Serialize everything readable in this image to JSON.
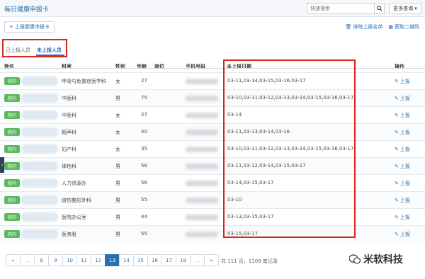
{
  "app": {
    "title": "每日健康申报卡"
  },
  "search": {
    "placeholder": "快速搜索",
    "more_label": "更多查询"
  },
  "toolbar": {
    "report_label": "上报健康申报卡",
    "delete_label": "排除上报名单",
    "qr_label": "获取二维码"
  },
  "tabs": [
    {
      "label": "已上报人员"
    },
    {
      "label": "未上报人员",
      "active": true
    }
  ],
  "table": {
    "headers": {
      "name": "姓名",
      "dept": "科室",
      "gender": "性别",
      "age": "年龄",
      "post": "岗位",
      "phone": "手机号码",
      "dates": "未上报日期",
      "action": "操作"
    },
    "badge": "院内",
    "action_label": "上报",
    "rows": [
      {
        "dept": "呼吸与危重症医学科",
        "gender": "女",
        "age": "27",
        "dates": "03-11,03-14,03-15,03-16,03-17"
      },
      {
        "dept": "中医科",
        "gender": "男",
        "age": "75",
        "dates": "03-10,03-11,03-12,03-13,03-14,03-15,03-16,03-17"
      },
      {
        "dept": "中医科",
        "gender": "女",
        "age": "27",
        "dates": "03-14"
      },
      {
        "dept": "超声科",
        "gender": "女",
        "age": "40",
        "dates": "03-11,03-13,03-14,03-16"
      },
      {
        "dept": "妇产科",
        "gender": "女",
        "age": "35",
        "dates": "03-10,03-11,03-12,03-13,03-14,03-15,03-16,03-17"
      },
      {
        "dept": "体检科",
        "gender": "男",
        "age": "56",
        "dates": "03-11,03-12,03-14,03-15,03-17"
      },
      {
        "dept": "人力资源办",
        "gender": "男",
        "age": "56",
        "dates": "03-14,03-15,03-17"
      },
      {
        "dept": "烧伤整形外科",
        "gender": "男",
        "age": "55",
        "dates": "03-10"
      },
      {
        "dept": "医院办公室",
        "gender": "男",
        "age": "44",
        "dates": "03-13,03-15,03-17"
      },
      {
        "dept": "医务股",
        "gender": "男",
        "age": "55",
        "dates": "03-15,03-17"
      }
    ]
  },
  "pagination": {
    "pages": [
      "«",
      "...",
      "8",
      "9",
      "10",
      "11",
      "12",
      "13",
      "14",
      "15",
      "16",
      "17",
      "18",
      "...",
      "»"
    ],
    "active": "13",
    "info": "共 111 页，1109 笔记录"
  },
  "watermark": {
    "text": "米软科技"
  },
  "colors": {
    "accent": "#2a6fb0",
    "badge": "#5cb85c",
    "highlight": "#d9261c"
  }
}
